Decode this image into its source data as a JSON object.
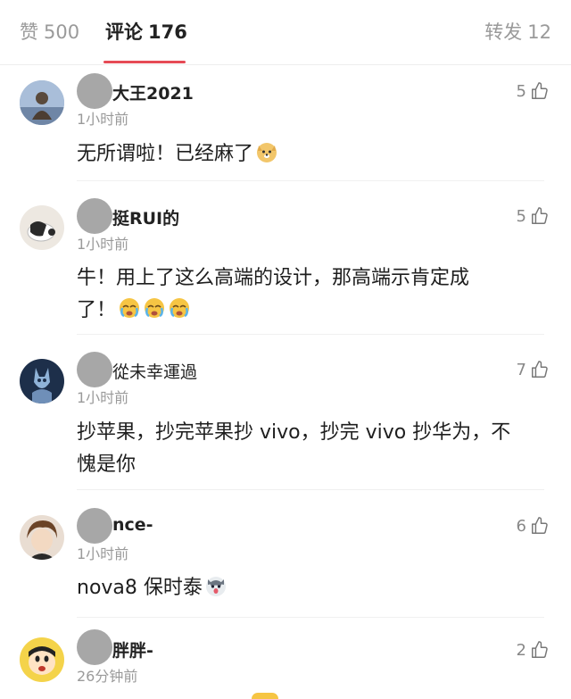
{
  "tabs": [
    {
      "label": "赞",
      "count": "500"
    },
    {
      "label": "评论",
      "count": "176"
    },
    {
      "label": "转发",
      "count": "12"
    }
  ],
  "comments": [
    {
      "name": "大王2021",
      "time": "1小时前",
      "likes": "5",
      "text": "无所谓啦！已经麻了",
      "emoji": [
        "doge"
      ]
    },
    {
      "name": "挺RUI的",
      "time": "1小时前",
      "likes": "5",
      "text_line1": "牛！用上了这么高端的设计，那高端示肯定成",
      "text_line2": "了！",
      "emoji": [
        "crying",
        "crying",
        "crying"
      ]
    },
    {
      "name": "從未幸運過",
      "time": "1小时前",
      "likes": "7",
      "text_line1": "抄苹果，抄完苹果抄 vivo，抄完 vivo 抄华为，不",
      "text_line2": "愧是你"
    },
    {
      "name": "nce-",
      "time": "1小时前",
      "likes": "6",
      "text": "nova8 保时泰",
      "emoji": [
        "husky"
      ]
    },
    {
      "name": "胖胖-",
      "time": "26分钟前",
      "likes": "2"
    }
  ]
}
